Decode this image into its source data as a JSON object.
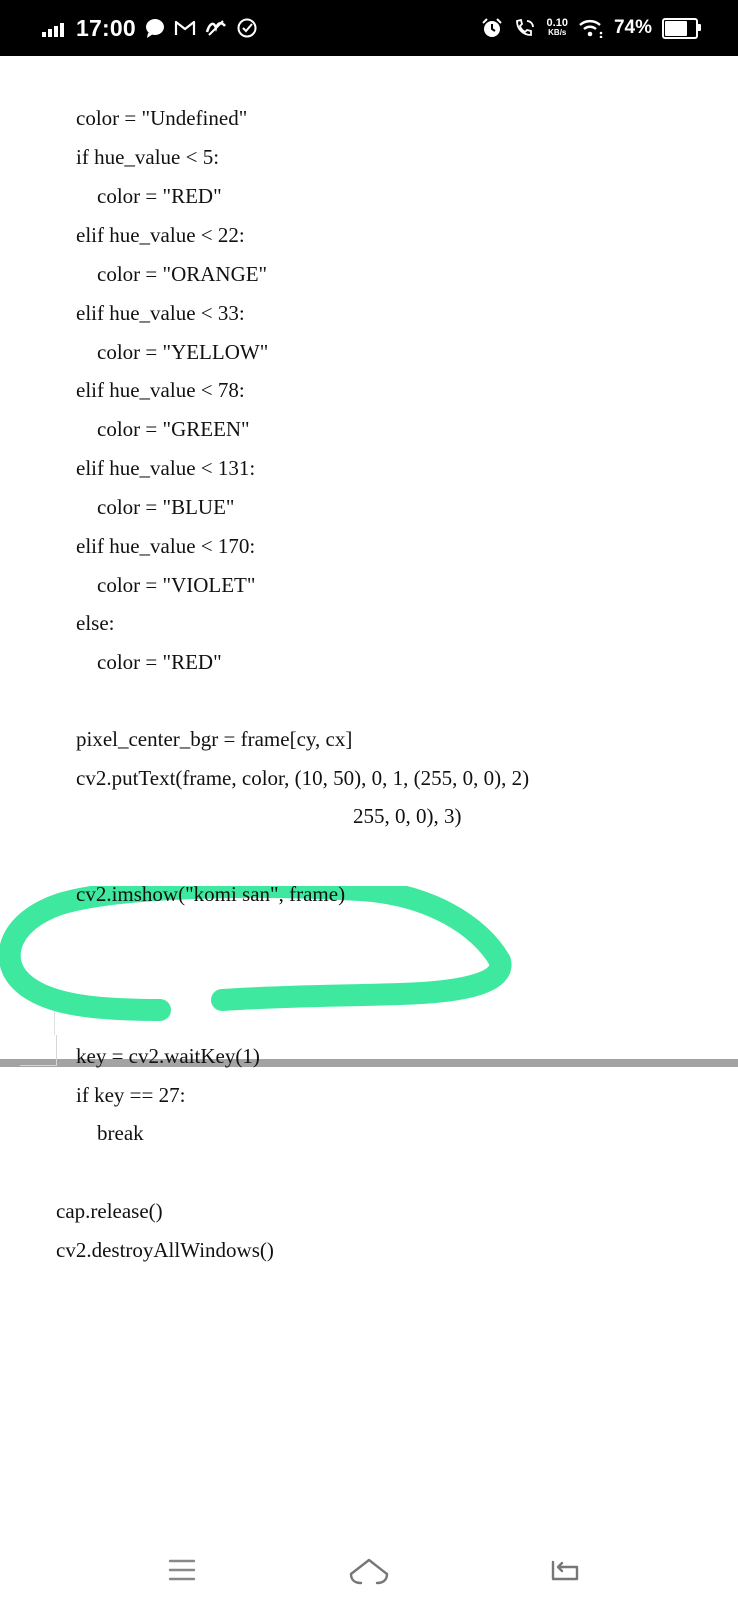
{
  "status_bar": {
    "time": "17:00",
    "left_icons": [
      "chat-bubble-icon",
      "gmail-icon",
      "app-icon",
      "check-circle-icon"
    ],
    "network_speed_value": "0.10",
    "network_speed_unit": "KB/s",
    "battery_percent": "74%",
    "battery_level": 0.74
  },
  "document": {
    "code_lines": [
      "color = \"Undefined\"",
      "if hue_value < 5:",
      "    color = \"RED\"",
      "elif hue_value < 22:",
      "    color = \"ORANGE\"",
      "elif hue_value < 33:",
      "    color = \"YELLOW\"",
      "elif hue_value < 78:",
      "    color = \"GREEN\"",
      "elif hue_value < 131:",
      "    color = \"BLUE\"",
      "elif hue_value < 170:",
      "    color = \"VIOLET\"",
      "else:",
      "    color = \"RED\"",
      "pixel_center_bgr = frame[cy, cx]",
      "cv2.putText(frame, color, (10, 50), 0, 1, (255, 0, 0), 2)",
      "255, 0, 0), 3)",
      "cv2.imshow(\"komi san\", frame)",
      "key = cv2.waitKey(1)",
      "if key == 27:",
      "    break",
      "cap.release()",
      "cv2.destroyAllWindows()"
    ],
    "annotation_color": "#3ee89f"
  },
  "nav_bar": {
    "buttons": [
      "menu-icon",
      "home-icon",
      "back-icon"
    ]
  }
}
